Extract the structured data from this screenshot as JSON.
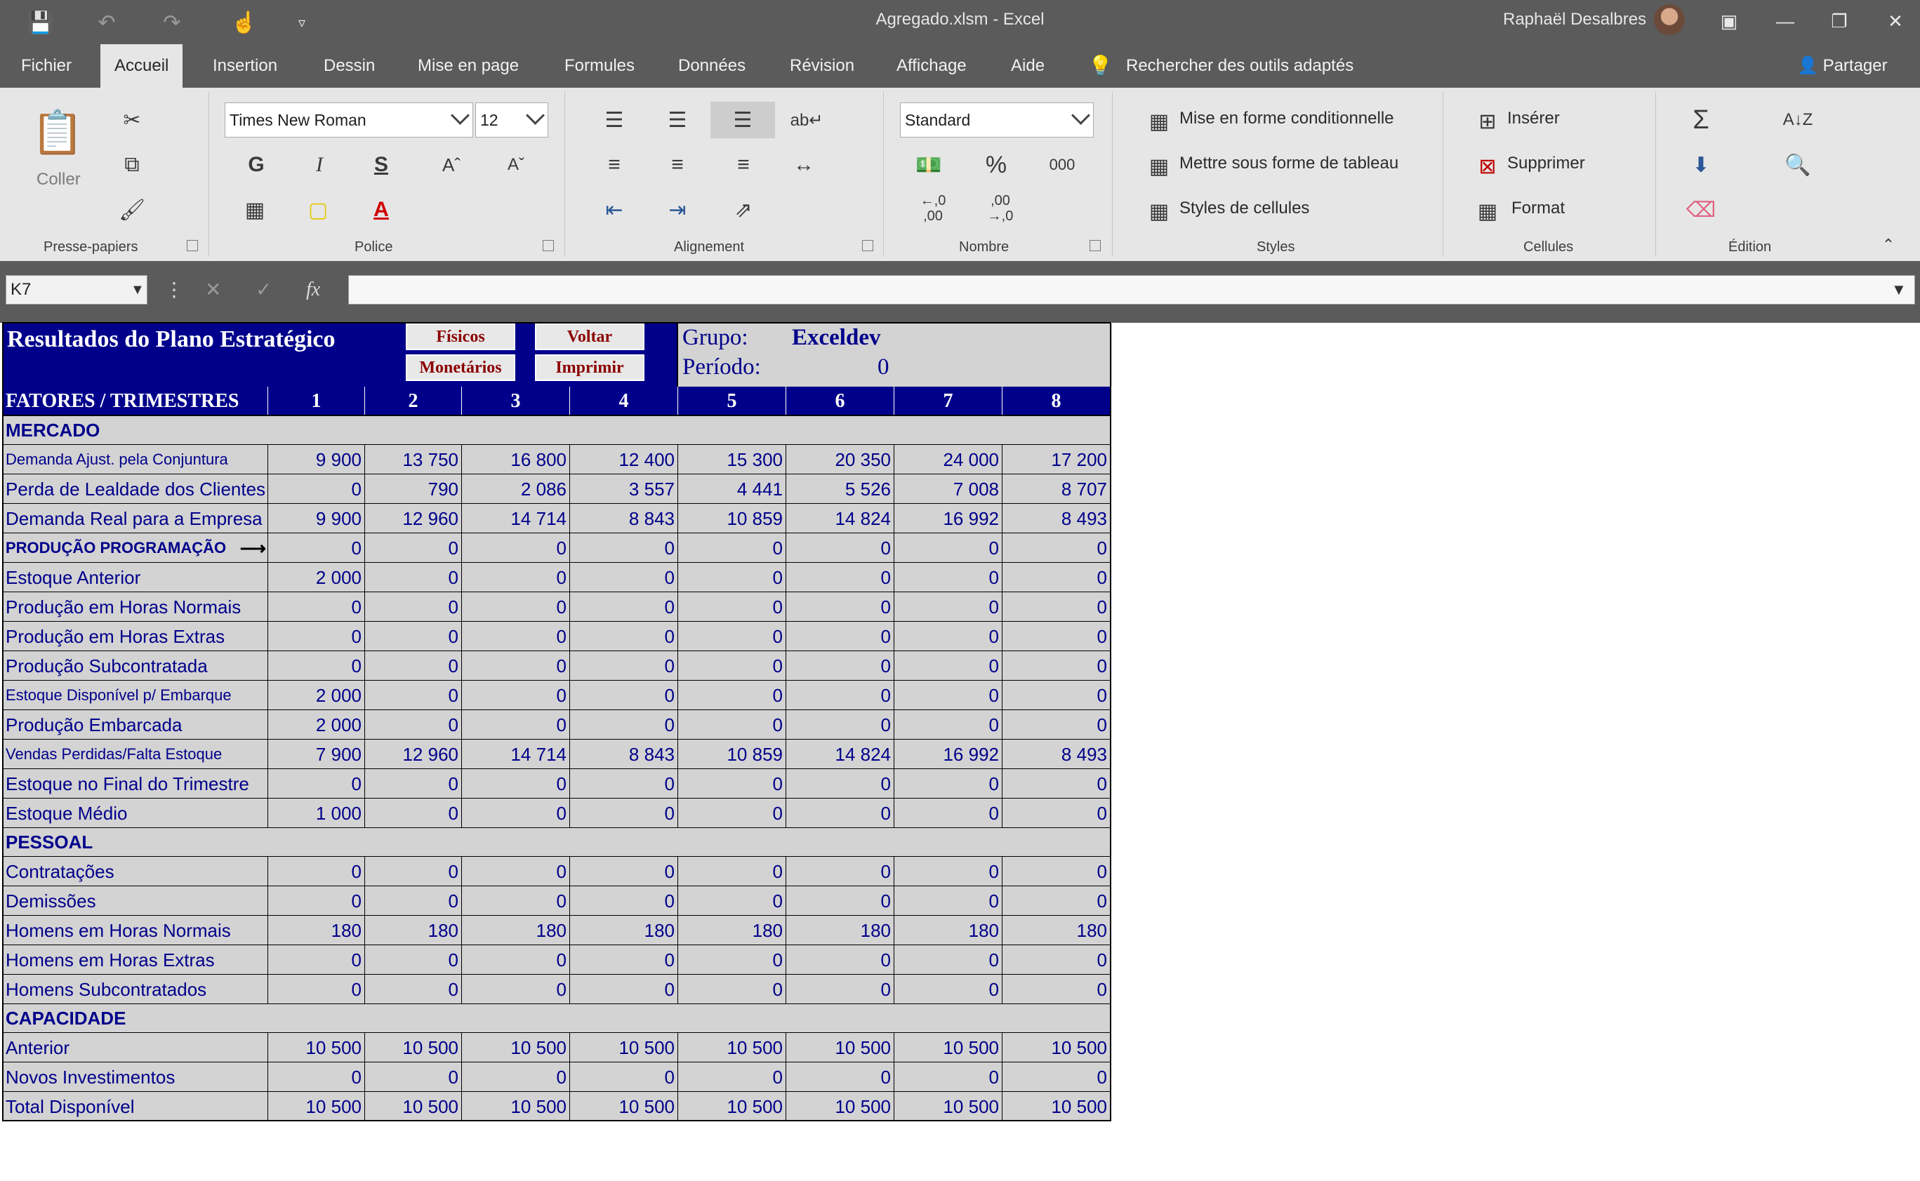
{
  "window": {
    "title": "Agregado.xlsm  -  Excel",
    "user": "Raphaël Desalbres"
  },
  "tabs": [
    "Fichier",
    "Accueil",
    "Insertion",
    "Dessin",
    "Mise en page",
    "Formules",
    "Données",
    "Révision",
    "Affichage",
    "Aide"
  ],
  "tell_me": "Rechercher des outils adaptés",
  "share": "Partager",
  "ribbon": {
    "clipboard": {
      "paste": "Coller",
      "label": "Presse-papiers"
    },
    "font": {
      "name": "Times New Roman",
      "size": "12",
      "bold": "G",
      "italic": "I",
      "underline": "S",
      "label": "Police"
    },
    "alignment": {
      "label": "Alignement"
    },
    "number": {
      "format": "Standard",
      "percent": "%",
      "thousands": "000",
      "inc_dec": "←,0\n,00",
      "dec_dec": ",00\n→,0",
      "label": "Nombre"
    },
    "styles": {
      "conditional": "Mise en forme conditionnelle",
      "table": "Mettre sous forme de tableau",
      "cell_styles": "Styles de cellules",
      "label": "Styles"
    },
    "cells": {
      "insert": "Insérer",
      "delete": "Supprimer",
      "format": "Format",
      "label": "Cellules"
    },
    "editing": {
      "label": "Édition"
    }
  },
  "formula_bar": {
    "name_box": "K7",
    "fx": "fx",
    "value": ""
  },
  "sheet": {
    "title": "Resultados do Plano Estratégico",
    "buttons": {
      "fisicos": "Físicos",
      "monetarios": "Monetários",
      "voltar": "Voltar",
      "imprimir": "Imprimir"
    },
    "grupo_label": "Grupo:",
    "grupo_value": "Exceldev",
    "periodo_label": "Período:",
    "periodo_value": "0",
    "header": [
      "FATORES / TRIMESTRES",
      "1",
      "2",
      "3",
      "4",
      "5",
      "6",
      "7",
      "8"
    ],
    "rows": [
      {
        "type": "section",
        "label": "MERCADO"
      },
      {
        "type": "data",
        "label": "Demanda Ajust. pela Conjuntura",
        "small": true,
        "values": [
          "9 900",
          "13 750",
          "16 800",
          "12 400",
          "15 300",
          "20 350",
          "24 000",
          "17 200"
        ]
      },
      {
        "type": "data",
        "label": "Perda de Lealdade dos Clientes",
        "values": [
          "0",
          "790",
          "2 086",
          "3 557",
          "4 441",
          "5 526",
          "7 008",
          "8 707"
        ]
      },
      {
        "type": "data",
        "label": "Demanda Real para a Empresa",
        "values": [
          "9 900",
          "12 960",
          "14 714",
          "8 843",
          "10 859",
          "14 824",
          "16 992",
          "8 493"
        ]
      },
      {
        "type": "prog",
        "label": "PRODUÇÃO  PROGRAMAÇÃO",
        "values": [
          "0",
          "0",
          "0",
          "0",
          "0",
          "0",
          "0",
          "0"
        ]
      },
      {
        "type": "data",
        "label": "Estoque Anterior",
        "values": [
          "2 000",
          "0",
          "0",
          "0",
          "0",
          "0",
          "0",
          "0"
        ]
      },
      {
        "type": "data",
        "label": "Produção em Horas Normais",
        "values": [
          "0",
          "0",
          "0",
          "0",
          "0",
          "0",
          "0",
          "0"
        ]
      },
      {
        "type": "data",
        "label": "Produção em Horas Extras",
        "values": [
          "0",
          "0",
          "0",
          "0",
          "0",
          "0",
          "0",
          "0"
        ]
      },
      {
        "type": "data",
        "label": "Produção Subcontratada",
        "values": [
          "0",
          "0",
          "0",
          "0",
          "0",
          "0",
          "0",
          "0"
        ]
      },
      {
        "type": "data",
        "label": "Estoque Disponível p/ Embarque",
        "small": true,
        "values": [
          "2 000",
          "0",
          "0",
          "0",
          "0",
          "0",
          "0",
          "0"
        ]
      },
      {
        "type": "data",
        "label": "Produção Embarcada",
        "values": [
          "2 000",
          "0",
          "0",
          "0",
          "0",
          "0",
          "0",
          "0"
        ]
      },
      {
        "type": "data",
        "label": "Vendas Perdidas/Falta Estoque",
        "small": true,
        "values": [
          "7 900",
          "12 960",
          "14 714",
          "8 843",
          "10 859",
          "14 824",
          "16 992",
          "8 493"
        ]
      },
      {
        "type": "data",
        "label": "Estoque no Final do Trimestre",
        "values": [
          "0",
          "0",
          "0",
          "0",
          "0",
          "0",
          "0",
          "0"
        ]
      },
      {
        "type": "data",
        "label": "Estoque Médio",
        "values": [
          "1 000",
          "0",
          "0",
          "0",
          "0",
          "0",
          "0",
          "0"
        ]
      },
      {
        "type": "section",
        "label": "PESSOAL"
      },
      {
        "type": "data",
        "label": "Contratações",
        "values": [
          "0",
          "0",
          "0",
          "0",
          "0",
          "0",
          "0",
          "0"
        ]
      },
      {
        "type": "data",
        "label": "Demissões",
        "values": [
          "0",
          "0",
          "0",
          "0",
          "0",
          "0",
          "0",
          "0"
        ]
      },
      {
        "type": "data",
        "label": "Homens em Horas Normais",
        "values": [
          "180",
          "180",
          "180",
          "180",
          "180",
          "180",
          "180",
          "180"
        ]
      },
      {
        "type": "data",
        "label": "Homens em Horas Extras",
        "values": [
          "0",
          "0",
          "0",
          "0",
          "0",
          "0",
          "0",
          "0"
        ]
      },
      {
        "type": "data",
        "label": "Homens Subcontratados",
        "values": [
          "0",
          "0",
          "0",
          "0",
          "0",
          "0",
          "0",
          "0"
        ]
      },
      {
        "type": "section",
        "label": "CAPACIDADE"
      },
      {
        "type": "data",
        "label": "Anterior",
        "values": [
          "10 500",
          "10 500",
          "10 500",
          "10 500",
          "10 500",
          "10 500",
          "10 500",
          "10 500"
        ]
      },
      {
        "type": "data",
        "label": "Novos Investimentos",
        "values": [
          "0",
          "0",
          "0",
          "0",
          "0",
          "0",
          "0",
          "0"
        ]
      },
      {
        "type": "data",
        "label": "Total Disponível",
        "values": [
          "10 500",
          "10 500",
          "10 500",
          "10 500",
          "10 500",
          "10 500",
          "10 500",
          "10 500"
        ]
      }
    ]
  }
}
